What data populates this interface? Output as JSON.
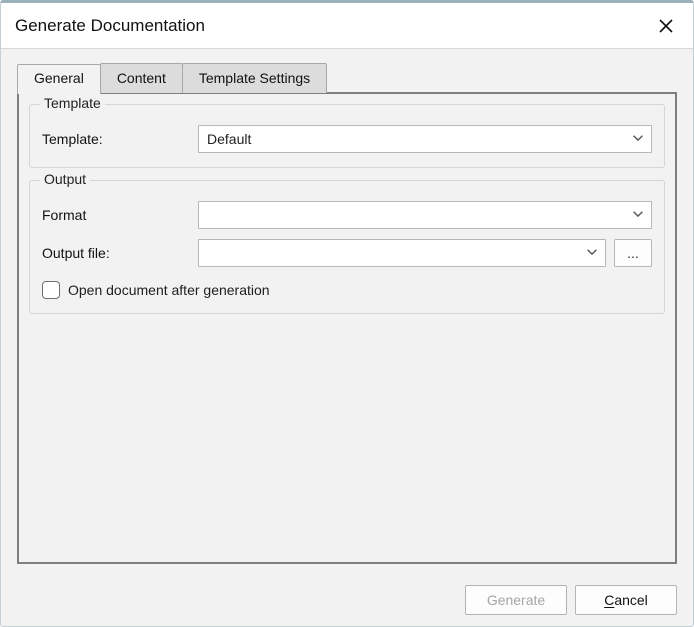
{
  "window": {
    "title": "Generate Documentation"
  },
  "tabs": [
    {
      "label": "General",
      "active": true
    },
    {
      "label": "Content",
      "active": false
    },
    {
      "label": "Template Settings",
      "active": false
    }
  ],
  "groups": {
    "template": {
      "title": "Template",
      "fields": {
        "template": {
          "label": "Template:",
          "value": "Default"
        }
      }
    },
    "output": {
      "title": "Output",
      "fields": {
        "format": {
          "label": "Format",
          "value": ""
        },
        "output_file": {
          "label": "Output file:",
          "value": "",
          "browse": "..."
        }
      },
      "checkbox": {
        "label": "Open document after generation",
        "checked": false
      }
    }
  },
  "footer": {
    "generate": "Generate",
    "cancel_pre": "",
    "cancel_u": "C",
    "cancel_post": "ancel"
  }
}
